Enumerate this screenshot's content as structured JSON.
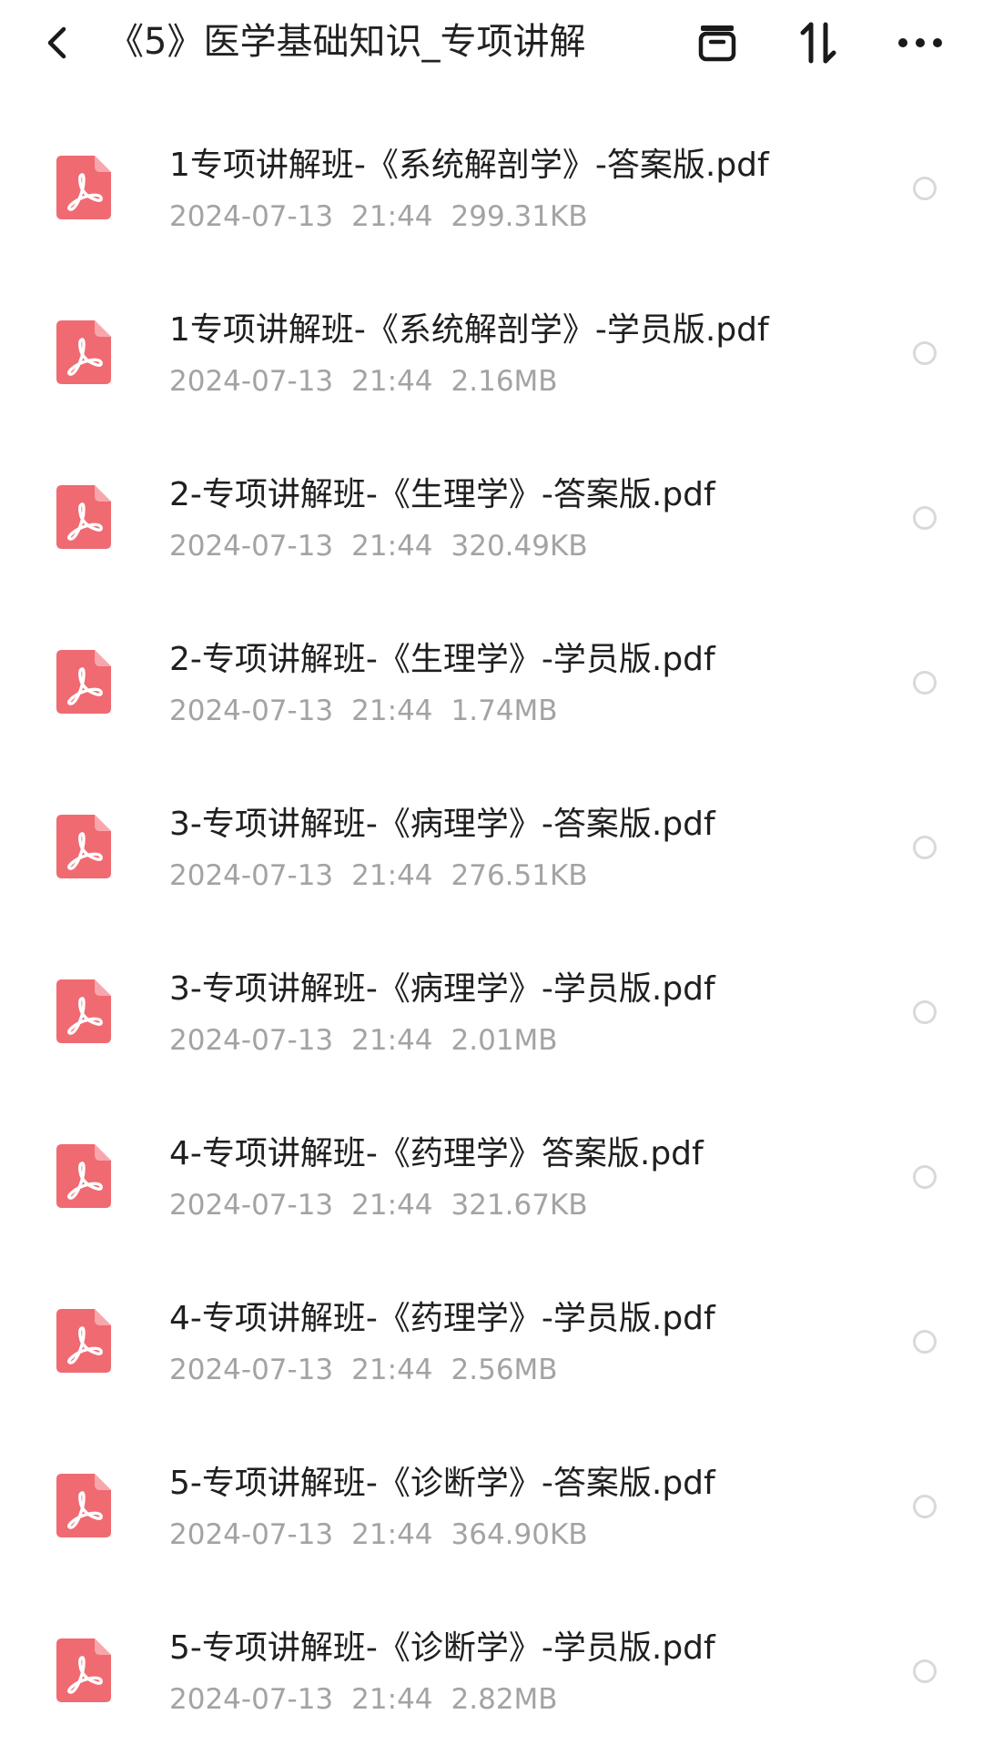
{
  "header": {
    "title": "《5》医学基础知识_专项讲解",
    "icons": {
      "back": "back-arrow-icon",
      "archive": "archive-icon",
      "sort": "sort-icon",
      "more": "more-icon"
    }
  },
  "colors": {
    "pdf_accent": "#f06a72",
    "meta_text": "#a3a3a3",
    "radio_border": "#d9d9d9"
  },
  "files": [
    {
      "name": "1专项讲解班-《系统解剖学》-答案版.pdf",
      "date": "2024-07-13",
      "time": "21:44",
      "size": "299.31KB",
      "icon": "pdf-icon"
    },
    {
      "name": "1专项讲解班-《系统解剖学》-学员版.pdf",
      "date": "2024-07-13",
      "time": "21:44",
      "size": "2.16MB",
      "icon": "pdf-icon"
    },
    {
      "name": "2-专项讲解班-《生理学》-答案版.pdf",
      "date": "2024-07-13",
      "time": "21:44",
      "size": "320.49KB",
      "icon": "pdf-icon"
    },
    {
      "name": "2-专项讲解班-《生理学》-学员版.pdf",
      "date": "2024-07-13",
      "time": "21:44",
      "size": "1.74MB",
      "icon": "pdf-icon"
    },
    {
      "name": "3-专项讲解班-《病理学》-答案版.pdf",
      "date": "2024-07-13",
      "time": "21:44",
      "size": "276.51KB",
      "icon": "pdf-icon"
    },
    {
      "name": "3-专项讲解班-《病理学》-学员版.pdf",
      "date": "2024-07-13",
      "time": "21:44",
      "size": "2.01MB",
      "icon": "pdf-icon"
    },
    {
      "name": "4-专项讲解班-《药理学》答案版.pdf",
      "date": "2024-07-13",
      "time": "21:44",
      "size": "321.67KB",
      "icon": "pdf-icon"
    },
    {
      "name": "4-专项讲解班-《药理学》-学员版.pdf",
      "date": "2024-07-13",
      "time": "21:44",
      "size": "2.56MB",
      "icon": "pdf-icon"
    },
    {
      "name": "5-专项讲解班-《诊断学》-答案版.pdf",
      "date": "2024-07-13",
      "time": "21:44",
      "size": "364.90KB",
      "icon": "pdf-icon"
    },
    {
      "name": "5-专项讲解班-《诊断学》-学员版.pdf",
      "date": "2024-07-13",
      "time": "21:44",
      "size": "2.82MB",
      "icon": "pdf-icon"
    }
  ]
}
